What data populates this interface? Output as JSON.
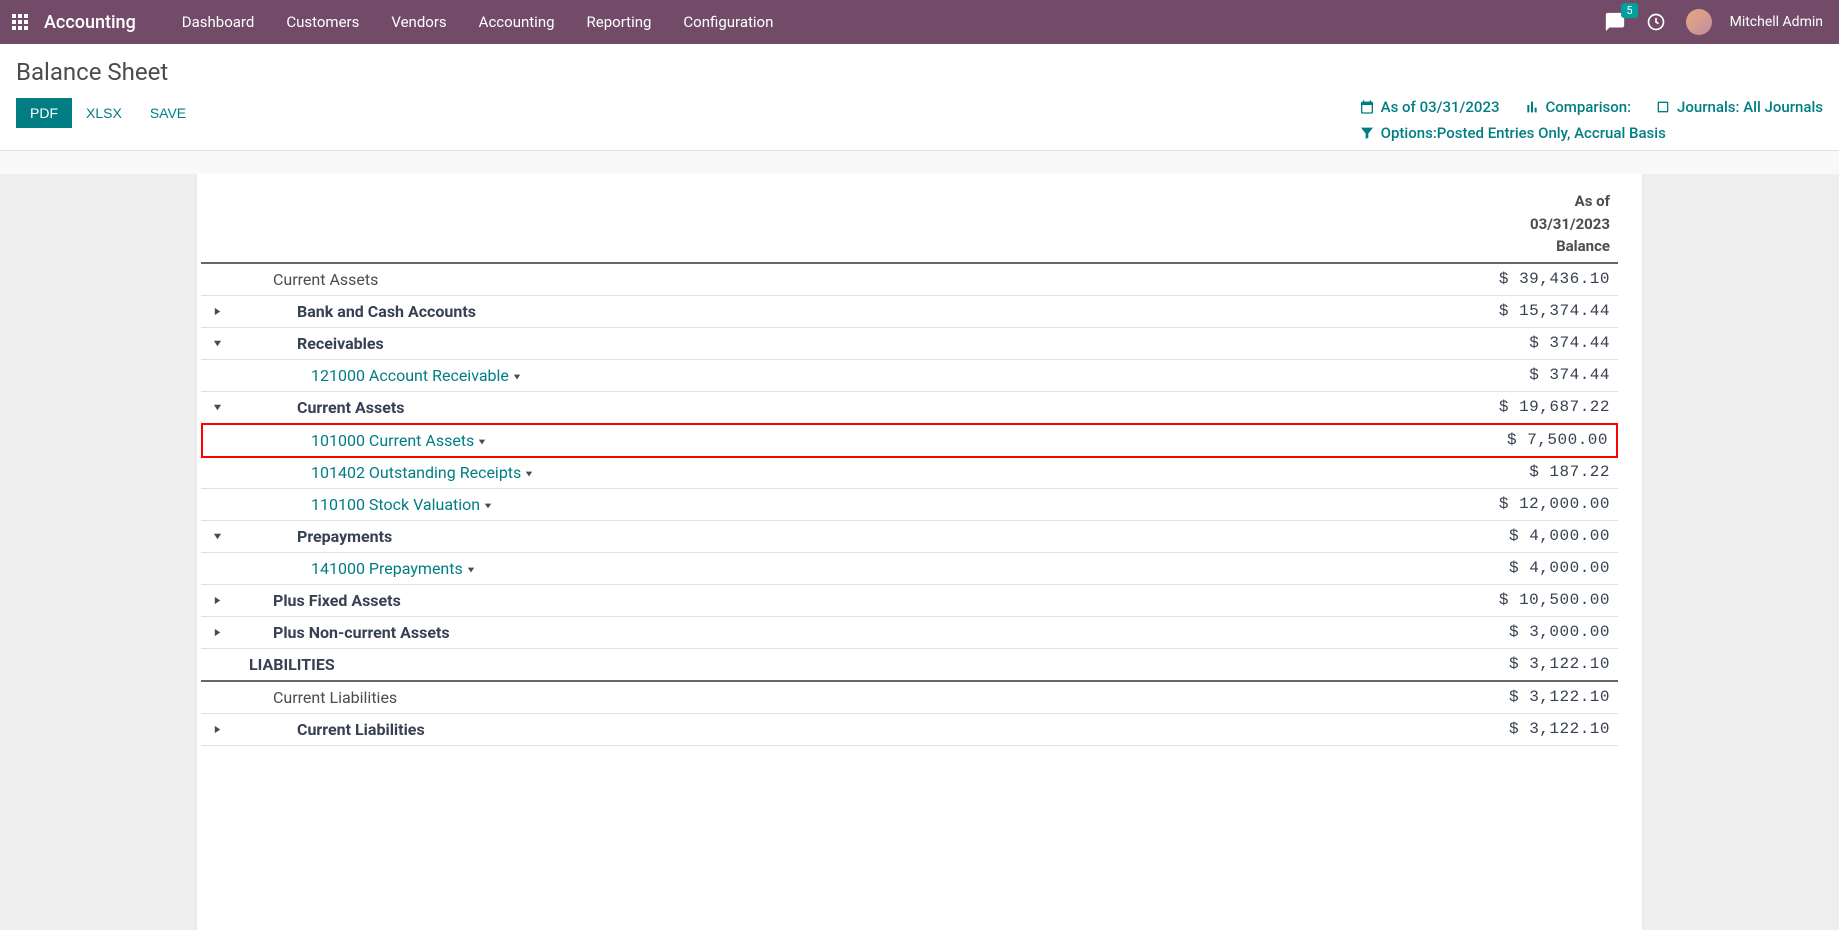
{
  "navbar": {
    "brand": "Accounting",
    "menu": [
      "Dashboard",
      "Customers",
      "Vendors",
      "Accounting",
      "Reporting",
      "Configuration"
    ],
    "badge_count": "5",
    "user_name": "Mitchell Admin"
  },
  "controlPanel": {
    "title": "Balance Sheet",
    "buttons": {
      "pdf": "PDF",
      "xlsx": "XLSX",
      "save": "SAVE"
    },
    "filters": {
      "as_of": "As of 03/31/2023",
      "comparison": "Comparison:",
      "journals": "Journals: All Journals",
      "options": "Options:Posted Entries Only, Accrual Basis"
    }
  },
  "report": {
    "header": {
      "line1": "As of",
      "line2": "03/31/2023",
      "line3": "Balance"
    },
    "rows": [
      {
        "caret": "",
        "indent": 1,
        "label": "Current Assets",
        "link": false,
        "bold": false,
        "value": "$ 39,436.10",
        "sectionBreak": false,
        "hl": false
      },
      {
        "caret": "right",
        "indent": 2,
        "label": "Bank and Cash Accounts",
        "link": false,
        "bold": true,
        "value": "$ 15,374.44",
        "sectionBreak": false,
        "hl": false
      },
      {
        "caret": "down",
        "indent": 2,
        "label": "Receivables",
        "link": false,
        "bold": true,
        "value": "$ 374.44",
        "sectionBreak": false,
        "hl": false
      },
      {
        "caret": "",
        "indent": 3,
        "label": "121000 Account Receivable",
        "link": true,
        "bold": false,
        "value": "$ 374.44",
        "sectionBreak": false,
        "hl": false
      },
      {
        "caret": "down",
        "indent": 2,
        "label": "Current Assets",
        "link": false,
        "bold": true,
        "value": "$ 19,687.22",
        "sectionBreak": false,
        "hl": false
      },
      {
        "caret": "",
        "indent": 3,
        "label": "101000 Current Assets",
        "link": true,
        "bold": false,
        "value": "$ 7,500.00",
        "sectionBreak": false,
        "hl": true
      },
      {
        "caret": "",
        "indent": 3,
        "label": "101402 Outstanding Receipts",
        "link": true,
        "bold": false,
        "value": "$ 187.22",
        "sectionBreak": false,
        "hl": false
      },
      {
        "caret": "",
        "indent": 3,
        "label": "110100 Stock Valuation",
        "link": true,
        "bold": false,
        "value": "$ 12,000.00",
        "sectionBreak": false,
        "hl": false
      },
      {
        "caret": "down",
        "indent": 2,
        "label": "Prepayments",
        "link": false,
        "bold": true,
        "value": "$ 4,000.00",
        "sectionBreak": false,
        "hl": false
      },
      {
        "caret": "",
        "indent": 3,
        "label": "141000 Prepayments",
        "link": true,
        "bold": false,
        "value": "$ 4,000.00",
        "sectionBreak": false,
        "hl": false
      },
      {
        "caret": "right",
        "indent": 1,
        "label": "Plus Fixed Assets",
        "link": false,
        "bold": true,
        "value": "$ 10,500.00",
        "sectionBreak": false,
        "hl": false
      },
      {
        "caret": "right",
        "indent": 1,
        "label": "Plus Non-current Assets",
        "link": false,
        "bold": true,
        "value": "$ 3,000.00",
        "sectionBreak": false,
        "hl": false
      },
      {
        "caret": "",
        "indent": 0,
        "label": "LIABILITIES",
        "link": false,
        "bold": true,
        "value": "$ 3,122.10",
        "sectionBreak": true,
        "hl": false
      },
      {
        "caret": "",
        "indent": 1,
        "label": "Current Liabilities",
        "link": false,
        "bold": false,
        "value": "$ 3,122.10",
        "sectionBreak": false,
        "hl": false
      },
      {
        "caret": "right",
        "indent": 2,
        "label": "Current Liabilities",
        "link": false,
        "bold": true,
        "value": "$ 3,122.10",
        "sectionBreak": false,
        "hl": false
      }
    ]
  }
}
